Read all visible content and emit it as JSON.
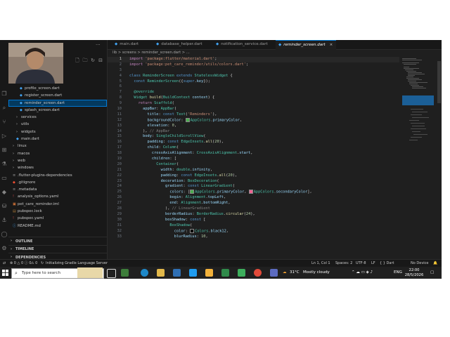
{
  "sidebar": {
    "tree": [
      {
        "label": "profile_screen.dart",
        "kind": "dart",
        "indent": 2
      },
      {
        "label": "register_screen.dart",
        "kind": "dart",
        "indent": 2
      },
      {
        "label": "reminder_screen.dart",
        "kind": "dart",
        "indent": 2,
        "selected": true
      },
      {
        "label": "splash_screen.dart",
        "kind": "dart",
        "indent": 2
      },
      {
        "label": "services",
        "kind": "folder",
        "indent": 1
      },
      {
        "label": "utils",
        "kind": "folder",
        "indent": 1
      },
      {
        "label": "widgets",
        "kind": "folder",
        "indent": 1
      },
      {
        "label": "main.dart",
        "kind": "dart",
        "indent": 1
      },
      {
        "label": "linux",
        "kind": "folder",
        "indent": 0
      },
      {
        "label": "macos",
        "kind": "folder",
        "indent": 0
      },
      {
        "label": "web",
        "kind": "folder",
        "indent": 0
      },
      {
        "label": "windows",
        "kind": "folder",
        "indent": 0
      },
      {
        "label": ".flutter-plugins-dependencies",
        "kind": "file",
        "indent": 0
      },
      {
        "label": ".gitignore",
        "kind": "git",
        "indent": 0
      },
      {
        "label": ".metadata",
        "kind": "file",
        "indent": 0
      },
      {
        "label": "analysis_options.yaml",
        "kind": "yaml",
        "indent": 0
      },
      {
        "label": "pet_care_reminder.iml",
        "kind": "iml",
        "indent": 0
      },
      {
        "label": "pubspec.lock",
        "kind": "lock",
        "indent": 0
      },
      {
        "label": "pubspec.yaml",
        "kind": "yaml",
        "indent": 0
      },
      {
        "label": "README.md",
        "kind": "md",
        "indent": 0
      }
    ],
    "sections": [
      "OUTLINE",
      "TIMELINE",
      "DEPENDENCIES"
    ]
  },
  "tabs": [
    {
      "label": "main.dart"
    },
    {
      "label": "database_helper.dart"
    },
    {
      "label": "notification_service.dart"
    },
    {
      "label": "reminder_screen.dart",
      "active": true,
      "close": "×"
    }
  ],
  "breadcrumb": "lib > screens > reminder_screen.dart > ...",
  "code": {
    "current_line": 1,
    "lines": [
      [
        [
          "k",
          "import "
        ],
        [
          "s",
          "'package:flutter/material.dart'"
        ],
        [
          "d",
          ";"
        ]
      ],
      [
        [
          "k",
          "import "
        ],
        [
          "s",
          "'package:pet_care_reminder/utils/colors.dart'"
        ],
        [
          "d",
          ";"
        ]
      ],
      [],
      [
        [
          "kb",
          "class "
        ],
        [
          "t",
          "ReminderScreen "
        ],
        [
          "kb",
          "extends "
        ],
        [
          "t",
          "StatelessWidget "
        ],
        [
          "d",
          "{"
        ]
      ],
      [
        [
          "d",
          "  "
        ],
        [
          "kb",
          "const "
        ],
        [
          "t",
          "ReminderScreen"
        ],
        [
          "d",
          "({"
        ],
        [
          "kb",
          "super"
        ],
        [
          "d",
          "."
        ],
        [
          "p",
          "key"
        ],
        [
          "d",
          "});"
        ]
      ],
      [],
      [
        [
          "d",
          "  "
        ],
        [
          "t",
          "@override"
        ]
      ],
      [
        [
          "d",
          "  "
        ],
        [
          "t",
          "Widget "
        ],
        [
          "f",
          "build"
        ],
        [
          "d",
          "("
        ],
        [
          "t",
          "BuildContext "
        ],
        [
          "p",
          "context"
        ],
        [
          "d",
          ") {"
        ]
      ],
      [
        [
          "d",
          "    "
        ],
        [
          "k",
          "return "
        ],
        [
          "t",
          "Scaffold"
        ],
        [
          "d",
          "("
        ]
      ],
      [
        [
          "d",
          "      "
        ],
        [
          "p",
          "appBar"
        ],
        [
          "d",
          ": "
        ],
        [
          "t",
          "AppBar"
        ],
        [
          "d",
          "("
        ]
      ],
      [
        [
          "d",
          "        "
        ],
        [
          "p",
          "title"
        ],
        [
          "d",
          ": "
        ],
        [
          "kb",
          "const "
        ],
        [
          "t",
          "Text"
        ],
        [
          "d",
          "("
        ],
        [
          "s",
          "'Reminders'"
        ],
        [
          "d",
          "),"
        ]
      ],
      [
        [
          "d",
          "        "
        ],
        [
          "p",
          "backgroundColor"
        ],
        [
          "d",
          ": "
        ],
        [
          "sw",
          "#4caf50"
        ],
        [
          "t",
          "AppColors"
        ],
        [
          "d",
          "."
        ],
        [
          "p",
          "primaryColor"
        ],
        [
          "d",
          ","
        ]
      ],
      [
        [
          "d",
          "        "
        ],
        [
          "p",
          "elevation"
        ],
        [
          "d",
          ": "
        ],
        [
          "n",
          "0"
        ],
        [
          "d",
          ","
        ]
      ],
      [
        [
          "d",
          "      ), "
        ],
        [
          "g",
          "// AppBar"
        ]
      ],
      [
        [
          "d",
          "      "
        ],
        [
          "p",
          "body"
        ],
        [
          "d",
          ": "
        ],
        [
          "t",
          "SingleChildScrollView"
        ],
        [
          "d",
          "("
        ]
      ],
      [
        [
          "d",
          "        "
        ],
        [
          "p",
          "padding"
        ],
        [
          "d",
          ": "
        ],
        [
          "kb",
          "const "
        ],
        [
          "t",
          "EdgeInsets"
        ],
        [
          "d",
          "."
        ],
        [
          "f",
          "all"
        ],
        [
          "d",
          "("
        ],
        [
          "n",
          "20"
        ],
        [
          "d",
          "),"
        ]
      ],
      [
        [
          "d",
          "        "
        ],
        [
          "p",
          "child"
        ],
        [
          "d",
          ": "
        ],
        [
          "t",
          "Column"
        ],
        [
          "d",
          "("
        ]
      ],
      [
        [
          "d",
          "          "
        ],
        [
          "p",
          "crossAxisAlignment"
        ],
        [
          "d",
          ": "
        ],
        [
          "t",
          "CrossAxisAlignment"
        ],
        [
          "d",
          "."
        ],
        [
          "p",
          "start"
        ],
        [
          "d",
          ","
        ]
      ],
      [
        [
          "d",
          "          "
        ],
        [
          "p",
          "children"
        ],
        [
          "d",
          ": ["
        ]
      ],
      [
        [
          "d",
          "            "
        ],
        [
          "t",
          "Container"
        ],
        [
          "d",
          "("
        ]
      ],
      [
        [
          "d",
          "              "
        ],
        [
          "p",
          "width"
        ],
        [
          "d",
          ": "
        ],
        [
          "t",
          "double"
        ],
        [
          "d",
          "."
        ],
        [
          "p",
          "infinity"
        ],
        [
          "d",
          ","
        ]
      ],
      [
        [
          "d",
          "              "
        ],
        [
          "p",
          "padding"
        ],
        [
          "d",
          ": "
        ],
        [
          "kb",
          "const "
        ],
        [
          "t",
          "EdgeInsets"
        ],
        [
          "d",
          "."
        ],
        [
          "f",
          "all"
        ],
        [
          "d",
          "("
        ],
        [
          "n",
          "20"
        ],
        [
          "d",
          "),"
        ]
      ],
      [
        [
          "d",
          "              "
        ],
        [
          "p",
          "decoration"
        ],
        [
          "d",
          ": "
        ],
        [
          "t",
          "BoxDecoration"
        ],
        [
          "d",
          "("
        ]
      ],
      [
        [
          "d",
          "                "
        ],
        [
          "p",
          "gradient"
        ],
        [
          "d",
          ": "
        ],
        [
          "kb",
          "const "
        ],
        [
          "t",
          "LinearGradient"
        ],
        [
          "d",
          "("
        ]
      ],
      [
        [
          "d",
          "                  "
        ],
        [
          "p",
          "colors"
        ],
        [
          "d",
          ": ["
        ],
        [
          "sw",
          "#4caf50"
        ],
        [
          "t",
          "AppColors"
        ],
        [
          "d",
          "."
        ],
        [
          "p",
          "primaryColor"
        ],
        [
          "d",
          ", "
        ],
        [
          "sw",
          "#f06292"
        ],
        [
          "t",
          "AppColors"
        ],
        [
          "d",
          "."
        ],
        [
          "p",
          "secondaryColor"
        ],
        [
          "d",
          "],"
        ]
      ],
      [
        [
          "d",
          "                  "
        ],
        [
          "p",
          "begin"
        ],
        [
          "d",
          ": "
        ],
        [
          "t",
          "Alignment"
        ],
        [
          "d",
          "."
        ],
        [
          "p",
          "topLeft"
        ],
        [
          "d",
          ","
        ]
      ],
      [
        [
          "d",
          "                  "
        ],
        [
          "p",
          "end"
        ],
        [
          "d",
          ": "
        ],
        [
          "t",
          "Alignment"
        ],
        [
          "d",
          "."
        ],
        [
          "p",
          "bottomRight"
        ],
        [
          "d",
          ","
        ]
      ],
      [
        [
          "d",
          "                ), "
        ],
        [
          "g",
          "// LinearGradient"
        ]
      ],
      [
        [
          "d",
          "                "
        ],
        [
          "p",
          "borderRadius"
        ],
        [
          "d",
          ": "
        ],
        [
          "t",
          "BorderRadius"
        ],
        [
          "d",
          "."
        ],
        [
          "f",
          "circular"
        ],
        [
          "d",
          "("
        ],
        [
          "n",
          "24"
        ],
        [
          "d",
          "),"
        ]
      ],
      [
        [
          "d",
          "                "
        ],
        [
          "p",
          "boxShadow"
        ],
        [
          "d",
          ": "
        ],
        [
          "kb",
          "const "
        ],
        [
          "d",
          "["
        ]
      ],
      [
        [
          "d",
          "                  "
        ],
        [
          "t",
          "BoxShadow"
        ],
        [
          "d",
          "("
        ]
      ],
      [
        [
          "d",
          "                    "
        ],
        [
          "p",
          "color"
        ],
        [
          "d",
          ": "
        ],
        [
          "sw",
          "#000000"
        ],
        [
          "t",
          "Colors"
        ],
        [
          "d",
          "."
        ],
        [
          "p",
          "black12"
        ],
        [
          "d",
          ","
        ]
      ],
      [
        [
          "d",
          "                    "
        ],
        [
          "p",
          "blurRadius"
        ],
        [
          "d",
          ": "
        ],
        [
          "n",
          "10"
        ],
        [
          "d",
          ","
        ]
      ]
    ]
  },
  "statusbar": {
    "left_counts": "⊗ 0 △ 0  ⓘ 0",
    "remote": "⚠ 0",
    "message": "Initializing Gradle Language Server",
    "position": "Ln 1, Col 1",
    "spaces": "Spaces: 2",
    "encoding": "UTF-8",
    "eol": "LF",
    "language": "{ } Dart",
    "device": "No Device"
  },
  "taskbar": {
    "search_placeholder": "Type here to search",
    "weather_temp": "31°C",
    "weather_desc": "Mostly cloudy",
    "language": "ENG",
    "time": "22:00",
    "date": "28/5/2026"
  },
  "colors": {
    "accent": "#0078d4",
    "editor_bg": "#1f1f1f",
    "sidebar_bg": "#181818",
    "taskbar_bg": "#202020"
  }
}
